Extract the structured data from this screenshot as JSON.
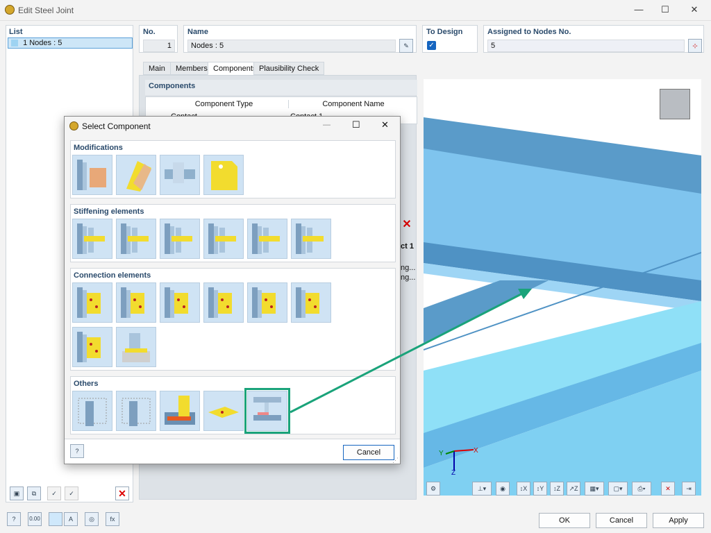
{
  "window": {
    "title": "Edit Steel Joint"
  },
  "list": {
    "header": "List",
    "items": [
      {
        "label": "1  Nodes : 5"
      }
    ]
  },
  "fields": {
    "no_label": "No.",
    "no_value": "1",
    "name_label": "Name",
    "name_value": "Nodes : 5",
    "design_label": "To Design",
    "nodes_label": "Assigned to Nodes No.",
    "nodes_value": "5"
  },
  "tabs": [
    {
      "label": "Main"
    },
    {
      "label": "Members"
    },
    {
      "label": "Components"
    },
    {
      "label": "Plausibility Check"
    }
  ],
  "components": {
    "header": "Components",
    "col_type": "Component Type",
    "col_name": "Component Name",
    "row_type": "Contact",
    "row_name": "Contact 1",
    "partial_name": "ct 1",
    "partial1": "ng...",
    "partial2": "ng..."
  },
  "dialog": {
    "title": "Select Component",
    "groups": [
      {
        "title": "Modifications"
      },
      {
        "title": "Stiffening elements"
      },
      {
        "title": "Connection elements"
      },
      {
        "title": "Others"
      }
    ],
    "cancel": "Cancel"
  },
  "axes": {
    "x": "X",
    "y": "Y",
    "z": "Z"
  },
  "footer": {
    "ok": "OK",
    "cancel": "Cancel",
    "apply": "Apply",
    "zero": "0.00"
  },
  "colors": {
    "accent_green": "#1aa37a",
    "beam_blue": "#7fc4ee",
    "plate_yellow": "#f2dc2e"
  }
}
